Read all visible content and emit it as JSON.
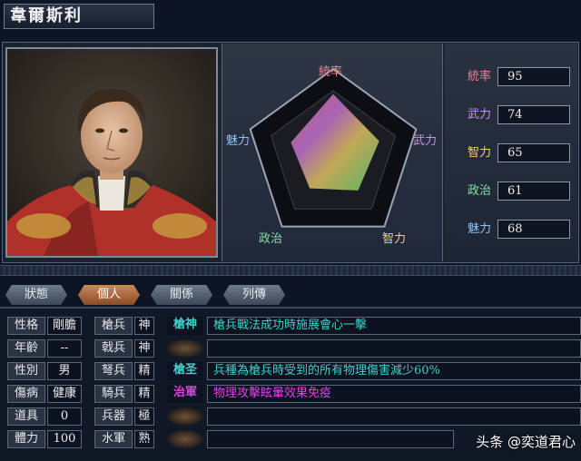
{
  "character": {
    "name": "韋爾斯利"
  },
  "radar": {
    "labels": {
      "leadership": "統率",
      "war": "武力",
      "intelligence": "智力",
      "politics": "政治",
      "charisma": "魅力"
    },
    "values": [
      95,
      74,
      65,
      61,
      68
    ],
    "max": 100
  },
  "stats": [
    {
      "label": "統率",
      "value": "95",
      "color": "#e07a8a"
    },
    {
      "label": "武力",
      "value": "74",
      "color": "#c07ae0"
    },
    {
      "label": "智力",
      "value": "65",
      "color": "#e0c070"
    },
    {
      "label": "政治",
      "value": "61",
      "color": "#7ad0a0"
    },
    {
      "label": "魅力",
      "value": "68",
      "color": "#80b0e8"
    }
  ],
  "tabs": [
    "狀態",
    "個人",
    "關係",
    "列傳"
  ],
  "active_tab": "個人",
  "attributes": [
    {
      "label": "性格",
      "value": "剛膽"
    },
    {
      "label": "年齡",
      "value": "--"
    },
    {
      "label": "性別",
      "value": "男"
    },
    {
      "label": "傷病",
      "value": "健康"
    },
    {
      "label": "道具",
      "value": "0"
    },
    {
      "label": "體力",
      "value": "100"
    }
  ],
  "skills": [
    {
      "name": "槍兵",
      "grade": "神",
      "tag": "槍神",
      "tag_color": "#40d0c8",
      "desc": "槍兵戰法成功時施展會心一擊",
      "desc_color": "#40d0c8"
    },
    {
      "name": "戟兵",
      "grade": "神",
      "tag": "",
      "tag_color": "",
      "desc": "",
      "desc_color": ""
    },
    {
      "name": "弩兵",
      "grade": "精",
      "tag": "槍圣",
      "tag_color": "#40d0c8",
      "desc": "兵種為槍兵時受到的所有物理傷害減少60%",
      "desc_color": "#40d0c8"
    },
    {
      "name": "騎兵",
      "grade": "精",
      "tag": "治軍",
      "tag_color": "#e040e0",
      "desc": "物理攻擊眩暈效果免疫",
      "desc_color": "#e040e0"
    },
    {
      "name": "兵器",
      "grade": "極",
      "tag": "",
      "tag_color": "",
      "desc": "",
      "desc_color": ""
    },
    {
      "name": "水軍",
      "grade": "熟",
      "tag": "",
      "tag_color": "",
      "desc": "",
      "desc_color": ""
    }
  ],
  "watermark": "头条 @奕道君心"
}
